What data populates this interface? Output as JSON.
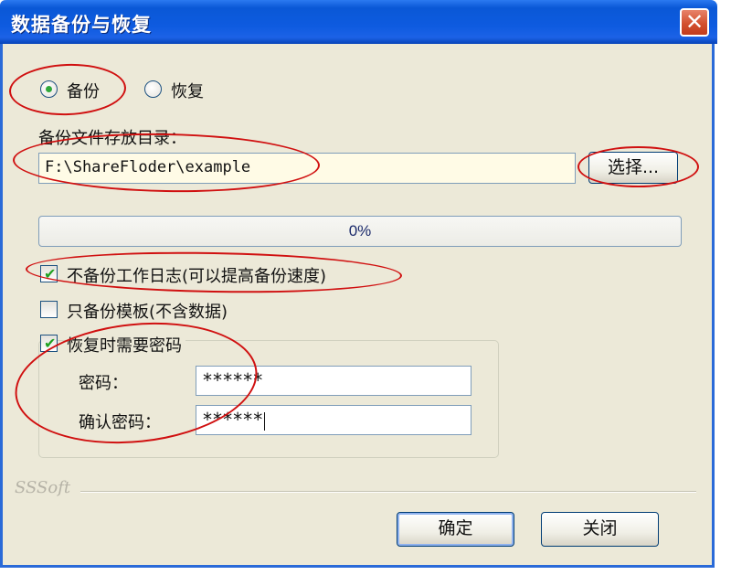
{
  "window": {
    "title": "数据备份与恢复",
    "close_glyph": "✕"
  },
  "mode": {
    "backup_label": "备份",
    "restore_label": "恢复",
    "selected": "backup"
  },
  "directory": {
    "label": "备份文件存放目录：",
    "value": "F:\\ShareFloder\\example",
    "browse_label": "选择..."
  },
  "progress": {
    "percent": 0,
    "text": "0%"
  },
  "options": {
    "skip_log": {
      "label": "不备份工作日志(可以提高备份速度)",
      "checked": true
    },
    "template_only": {
      "label": "只备份模板(不含数据)",
      "checked": false
    },
    "require_password": {
      "label": "恢复时需要密码",
      "checked": true
    }
  },
  "password": {
    "label": "密码：",
    "value": "******",
    "confirm_label": "确认密码：",
    "confirm_value": "******"
  },
  "footer": {
    "brand": "SSSoft",
    "ok_label": "确定",
    "close_label": "关闭"
  },
  "colors": {
    "titlebar": "#0a58d6",
    "dialog_bg": "#ece9d8",
    "annotation": "#d01010",
    "check": "#21a121"
  }
}
